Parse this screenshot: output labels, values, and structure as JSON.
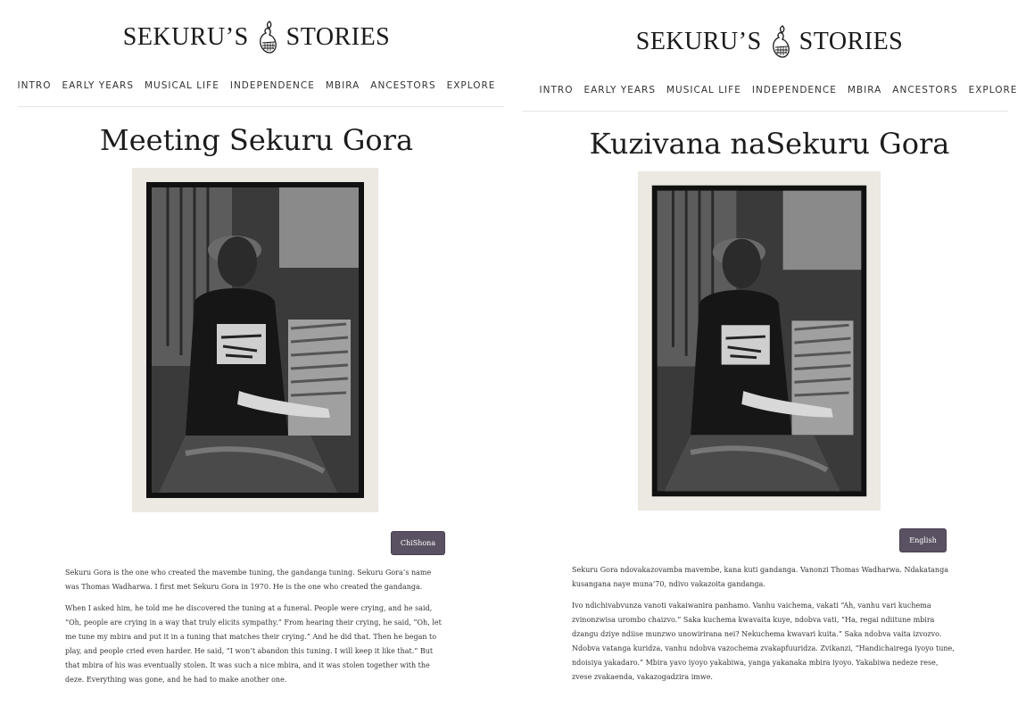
{
  "left": {
    "brand": {
      "before": "SEKURU’S",
      "after": "STORIES",
      "logo_icon": "gourd-mbira-logo-icon"
    },
    "nav": [
      "INTRO",
      "EARLY YEARS",
      "MUSICAL LIFE",
      "INDEPENDENCE",
      "MBIRA",
      "ANCESTORS",
      "EXPLORE"
    ],
    "title": "Meeting Sekuru Gora",
    "lang_button": "ChiShona",
    "paragraphs": [
      "Sekuru Gora is the one who created the mavembe tuning, the gandanga tuning. Sekuru Gora’s name was Thomas Wadharwa. I first met Sekuru Gora in 1970. He is the one who created the gandanga.",
      "When I asked him, he told me he discovered the tuning at a funeral. People were crying, and he said, “Oh, people are crying in a way that truly elicits sympathy.” From hearing their crying, he said, “Oh, let me tune my mbira and put it in a tuning that matches their crying.” And he did that. Then he began to play, and people cried even harder. He said, “I won’t abandon this tuning. I will keep it like that.” But that mbira of his was eventually stolen. It was such a nice mbira, and it was stolen together with the deze. Everything was gone, and he had to make another one."
    ]
  },
  "right": {
    "brand": {
      "before": "SEKURU’S",
      "after": "STORIES",
      "logo_icon": "gourd-mbira-logo-icon"
    },
    "nav": [
      "INTRO",
      "EARLY YEARS",
      "MUSICAL LIFE",
      "INDEPENDENCE",
      "MBIRA",
      "ANCESTORS",
      "EXPLORE"
    ],
    "title": "Kuzivana naSekuru Gora",
    "lang_button": "English",
    "paragraphs": [
      "Sekuru Gora ndovakazovamba mavembe, kana kuti gandanga. Vanonzi Thomas Wadharwa. Ndakatanga kusangana naye muna’70, ndivo vakazoita gandanga.",
      "Ivo ndichivabvunza vanoti vakaiwanira panhamo. Vanhu vaichema, vakati “Ah, vanhu vari kuchema zvinonzwisa urombo chaizvo.” Saka kuchema kwavaita kuye, ndobva vati, “Ha, regai ndiitune mbira dzangu dziye ndiise munzwo unowirirana nei? Nekuchema kwavari kuita.” Saka ndobva vaita izvozvo. Ndobva vatanga kuridza, vanhu ndobva vazochema zvakapfuuridza. Zvikanzi, “Handichairega iyoyo tune, ndoisiya yakadaro.” Mbira yavo iyoyo yakabiwa, yanga yakanaka mbira iyoyo. Yakabiwa nedeze rese, zvese zvakaenda, vakazogadzira imwe."
    ]
  },
  "colors": {
    "button_bg": "#5a5262",
    "photo_frame": "#ece8e2"
  }
}
